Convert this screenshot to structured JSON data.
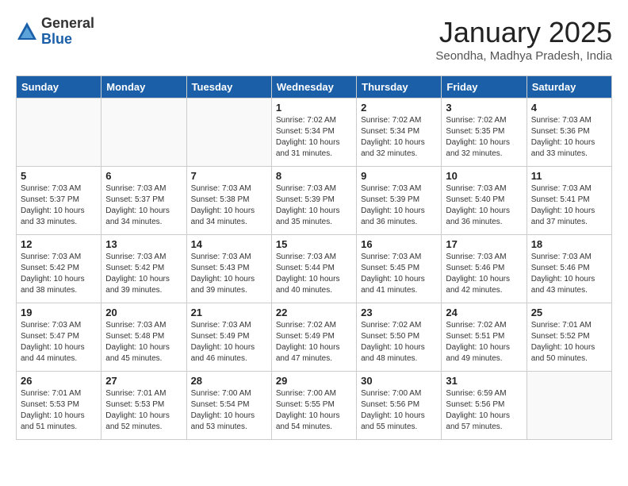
{
  "logo": {
    "general": "General",
    "blue": "Blue"
  },
  "title": "January 2025",
  "location": "Seondha, Madhya Pradesh, India",
  "days_header": [
    "Sunday",
    "Monday",
    "Tuesday",
    "Wednesday",
    "Thursday",
    "Friday",
    "Saturday"
  ],
  "weeks": [
    [
      {
        "day": "",
        "info": ""
      },
      {
        "day": "",
        "info": ""
      },
      {
        "day": "",
        "info": ""
      },
      {
        "day": "1",
        "info": "Sunrise: 7:02 AM\nSunset: 5:34 PM\nDaylight: 10 hours\nand 31 minutes."
      },
      {
        "day": "2",
        "info": "Sunrise: 7:02 AM\nSunset: 5:34 PM\nDaylight: 10 hours\nand 32 minutes."
      },
      {
        "day": "3",
        "info": "Sunrise: 7:02 AM\nSunset: 5:35 PM\nDaylight: 10 hours\nand 32 minutes."
      },
      {
        "day": "4",
        "info": "Sunrise: 7:03 AM\nSunset: 5:36 PM\nDaylight: 10 hours\nand 33 minutes."
      }
    ],
    [
      {
        "day": "5",
        "info": "Sunrise: 7:03 AM\nSunset: 5:37 PM\nDaylight: 10 hours\nand 33 minutes."
      },
      {
        "day": "6",
        "info": "Sunrise: 7:03 AM\nSunset: 5:37 PM\nDaylight: 10 hours\nand 34 minutes."
      },
      {
        "day": "7",
        "info": "Sunrise: 7:03 AM\nSunset: 5:38 PM\nDaylight: 10 hours\nand 34 minutes."
      },
      {
        "day": "8",
        "info": "Sunrise: 7:03 AM\nSunset: 5:39 PM\nDaylight: 10 hours\nand 35 minutes."
      },
      {
        "day": "9",
        "info": "Sunrise: 7:03 AM\nSunset: 5:39 PM\nDaylight: 10 hours\nand 36 minutes."
      },
      {
        "day": "10",
        "info": "Sunrise: 7:03 AM\nSunset: 5:40 PM\nDaylight: 10 hours\nand 36 minutes."
      },
      {
        "day": "11",
        "info": "Sunrise: 7:03 AM\nSunset: 5:41 PM\nDaylight: 10 hours\nand 37 minutes."
      }
    ],
    [
      {
        "day": "12",
        "info": "Sunrise: 7:03 AM\nSunset: 5:42 PM\nDaylight: 10 hours\nand 38 minutes."
      },
      {
        "day": "13",
        "info": "Sunrise: 7:03 AM\nSunset: 5:42 PM\nDaylight: 10 hours\nand 39 minutes."
      },
      {
        "day": "14",
        "info": "Sunrise: 7:03 AM\nSunset: 5:43 PM\nDaylight: 10 hours\nand 39 minutes."
      },
      {
        "day": "15",
        "info": "Sunrise: 7:03 AM\nSunset: 5:44 PM\nDaylight: 10 hours\nand 40 minutes."
      },
      {
        "day": "16",
        "info": "Sunrise: 7:03 AM\nSunset: 5:45 PM\nDaylight: 10 hours\nand 41 minutes."
      },
      {
        "day": "17",
        "info": "Sunrise: 7:03 AM\nSunset: 5:46 PM\nDaylight: 10 hours\nand 42 minutes."
      },
      {
        "day": "18",
        "info": "Sunrise: 7:03 AM\nSunset: 5:46 PM\nDaylight: 10 hours\nand 43 minutes."
      }
    ],
    [
      {
        "day": "19",
        "info": "Sunrise: 7:03 AM\nSunset: 5:47 PM\nDaylight: 10 hours\nand 44 minutes."
      },
      {
        "day": "20",
        "info": "Sunrise: 7:03 AM\nSunset: 5:48 PM\nDaylight: 10 hours\nand 45 minutes."
      },
      {
        "day": "21",
        "info": "Sunrise: 7:03 AM\nSunset: 5:49 PM\nDaylight: 10 hours\nand 46 minutes."
      },
      {
        "day": "22",
        "info": "Sunrise: 7:02 AM\nSunset: 5:49 PM\nDaylight: 10 hours\nand 47 minutes."
      },
      {
        "day": "23",
        "info": "Sunrise: 7:02 AM\nSunset: 5:50 PM\nDaylight: 10 hours\nand 48 minutes."
      },
      {
        "day": "24",
        "info": "Sunrise: 7:02 AM\nSunset: 5:51 PM\nDaylight: 10 hours\nand 49 minutes."
      },
      {
        "day": "25",
        "info": "Sunrise: 7:01 AM\nSunset: 5:52 PM\nDaylight: 10 hours\nand 50 minutes."
      }
    ],
    [
      {
        "day": "26",
        "info": "Sunrise: 7:01 AM\nSunset: 5:53 PM\nDaylight: 10 hours\nand 51 minutes."
      },
      {
        "day": "27",
        "info": "Sunrise: 7:01 AM\nSunset: 5:53 PM\nDaylight: 10 hours\nand 52 minutes."
      },
      {
        "day": "28",
        "info": "Sunrise: 7:00 AM\nSunset: 5:54 PM\nDaylight: 10 hours\nand 53 minutes."
      },
      {
        "day": "29",
        "info": "Sunrise: 7:00 AM\nSunset: 5:55 PM\nDaylight: 10 hours\nand 54 minutes."
      },
      {
        "day": "30",
        "info": "Sunrise: 7:00 AM\nSunset: 5:56 PM\nDaylight: 10 hours\nand 55 minutes."
      },
      {
        "day": "31",
        "info": "Sunrise: 6:59 AM\nSunset: 5:56 PM\nDaylight: 10 hours\nand 57 minutes."
      },
      {
        "day": "",
        "info": ""
      }
    ]
  ]
}
